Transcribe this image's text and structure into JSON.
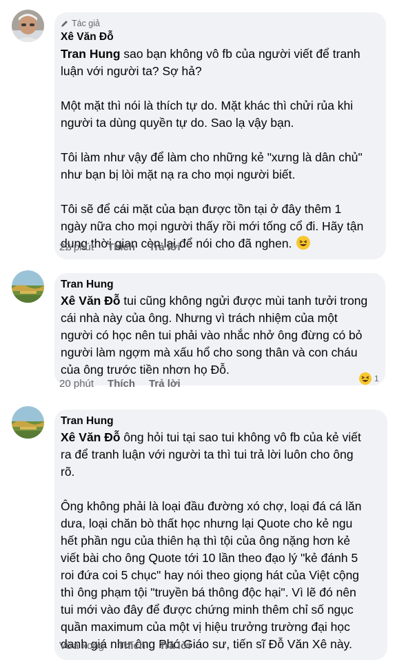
{
  "comments": [
    {
      "badge": "Tác giả",
      "author": "Xê Văn Đỗ",
      "paragraphs": [
        {
          "mention": "Tran Hung",
          "lines": [
            " sao bạn không vô fb của người viết để tranh",
            "luận với người ta? Sợ hả?"
          ]
        },
        {
          "lines": [
            "Một mặt thì nói là thích tự do. Mặt khác thì chửi rủa khi",
            "người ta dùng quyền tự do. Sao lạ vậy bạn."
          ]
        },
        {
          "lines": [
            "Tôi làm như vậy để làm cho những kẻ \"xưng là dân chủ\"",
            "như bạn bị lòi mặt nạ ra cho mọi người biết."
          ]
        },
        {
          "lines": [
            "Tôi sẽ để cái mặt của bạn được tồn tại ở đây thêm 1",
            "ngày nữa cho mọi người thấy rồi mới tống cổ đi. Hãy tận",
            "dụng thời gian còn lại để nói cho đã nghen."
          ]
        }
      ],
      "time": "22 phút",
      "like": "Thích",
      "reply": "Trả lời"
    },
    {
      "author": "Tran Hung",
      "paragraphs": [
        {
          "mention": "Xê Văn Đỗ",
          "lines": [
            " tui cũng không ngửi được mùi tanh tưởi trong",
            "cái nhà này của ông. Nhưng vì trách nhiệm của một",
            "người có học nên tui phải vào nhắc nhở ông đừng có bỏ",
            "người làm ngợm mà xấu hổ cho song thân và con cháu",
            "của ông trước tiền nhơn họ Đỗ."
          ]
        }
      ],
      "time": "20 phút",
      "like": "Thích",
      "reply": "Trả lời",
      "reaction_count": "1"
    },
    {
      "author": "Tran Hung",
      "paragraphs": [
        {
          "mention": "Xê Văn Đỗ",
          "lines": [
            " ông hỏi tui tại sao tui không vô fb của kẻ viết",
            "ra để tranh luận với người ta thì tui trả lời luôn cho ông",
            "rõ."
          ]
        },
        {
          "lines": [
            "Ông không phải là loại đầu đường xó chợ, loại đá cá lăn",
            "dưa, loại chăn bò thất học nhưng lại Quote cho kẻ ngu",
            "hết phần ngu của thiên hạ thì tội của ông nặng hơn kẻ",
            "viết bài cho ông Quote tới 10 lần theo đạo lý \"kẻ đánh 5",
            "roi đứa coi 5 chục\" hay nói theo giọng hát của Việt cộng",
            "thì ông phạm tội \"truyền bá thông độc hại\". Vì lẽ đó nên",
            "tui mới vào đây để được chứng minh thêm chỉ số ngục",
            "quần maximum của một vị hiệu trưởng trường đại học",
            "danh giá như ông Phó Giáo sư, tiến sĩ Đỗ Văn Xê này."
          ]
        }
      ],
      "time": "Vừa xong",
      "like": "Thích",
      "reply": "Trả lời"
    }
  ],
  "icons": {
    "badge": "pencil-icon",
    "emoji": "laughing-emoji-icon",
    "reaction": "haha-reaction-icon"
  },
  "colors": {
    "bubble": "#f0f2f5",
    "meta": "#65676b",
    "text": "#050505",
    "emoji": "#f7c72d"
  }
}
